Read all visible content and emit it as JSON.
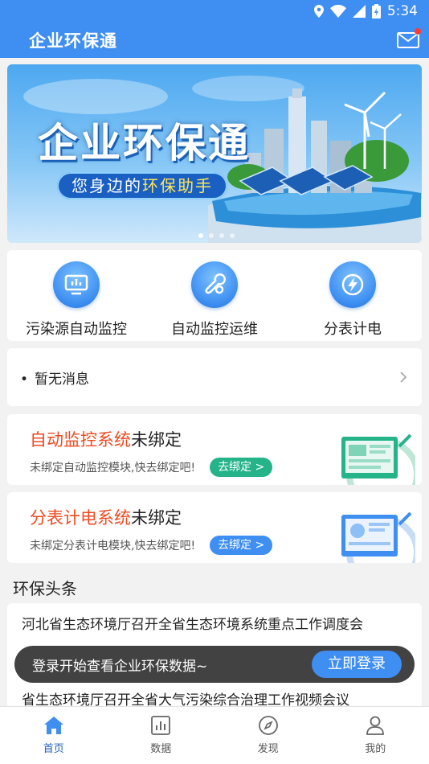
{
  "status_bar": {
    "time": "5:34"
  },
  "app": {
    "title": "企业环保通"
  },
  "banner": {
    "title": "企业环保通",
    "subtitle_prefix": "您身边的",
    "subtitle_highlight": "环保助手",
    "slide_count": 4,
    "active_slide": 1
  },
  "quick_actions": [
    {
      "label": "污染源自动监控",
      "icon": "monitor-screen-icon"
    },
    {
      "label": "自动监控运维",
      "icon": "wrench-gear-icon"
    },
    {
      "label": "分表计电",
      "icon": "lightning-icon"
    }
  ],
  "notice": {
    "text": "暂无消息"
  },
  "bind_cards": [
    {
      "title_highlight": "自动监控系统",
      "title_rest": "未绑定",
      "description": "未绑定自动监控模块,快去绑定吧!",
      "button": "去绑定 >",
      "accent": "#25b38a"
    },
    {
      "title_highlight": "分表计电系统",
      "title_rest": "未绑定",
      "description": "未绑定分表计电模块,快去绑定吧!",
      "button": "去绑定 >",
      "accent": "#3f8ef1"
    }
  ],
  "news": {
    "heading": "环保头条",
    "items": [
      "河北省生态环境厅召开全省生态环境系统重点工作调度会",
      "省生态环境厅召开全省大气污染综合治理工作视频会议"
    ]
  },
  "toast": {
    "text": "登录开始查看企业环保数据~",
    "button": "立即登录"
  },
  "tabs": [
    {
      "label": "首页",
      "icon": "home-icon",
      "active": true
    },
    {
      "label": "数据",
      "icon": "bar-chart-icon",
      "active": false
    },
    {
      "label": "发现",
      "icon": "compass-icon",
      "active": false
    },
    {
      "label": "我的",
      "icon": "user-icon",
      "active": false
    }
  ],
  "colors": {
    "primary": "#3f8ef1",
    "highlight_red": "#ef4a1f",
    "green": "#25b38a",
    "active_tab": "#1f5fbf"
  }
}
